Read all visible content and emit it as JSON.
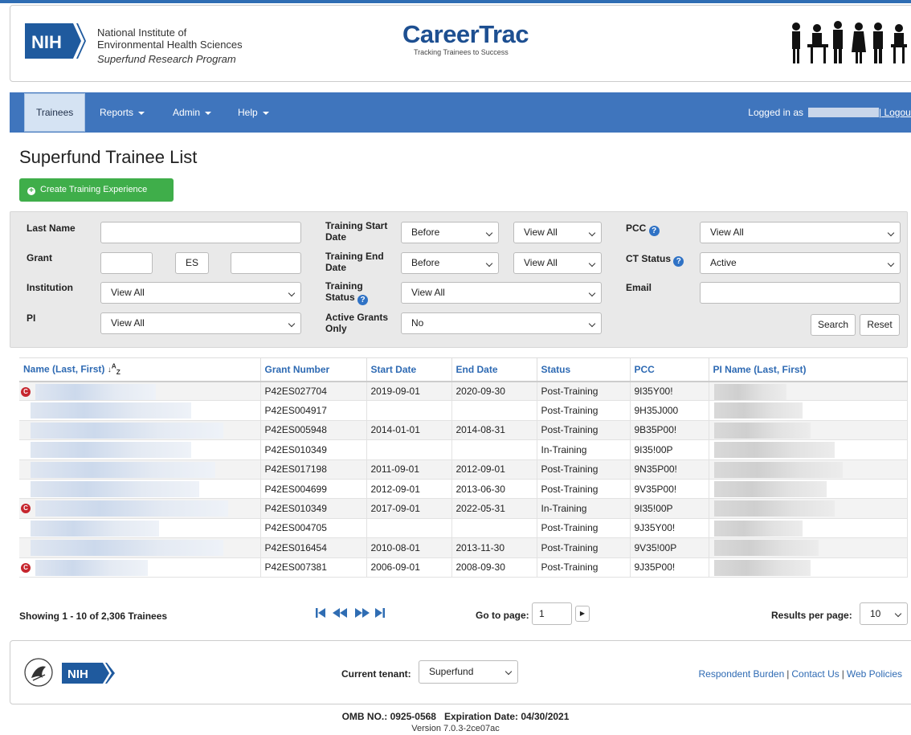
{
  "brand": {
    "nih_logo_text": "NIH",
    "institute_line1": "National Institute of",
    "institute_line2": "Environmental Health Sciences",
    "program": "Superfund Research Program",
    "app_name": "CareerTrac",
    "tagline": "Tracking Trainees to Success",
    "primary_color": "#3f75bd",
    "accent_color": "#3fae4a"
  },
  "nav": {
    "items": [
      {
        "label": "Trainees",
        "active": true
      },
      {
        "label": "Reports",
        "dropdown": true
      },
      {
        "label": "Admin",
        "dropdown": true
      },
      {
        "label": "Help",
        "dropdown": true
      }
    ],
    "logged_in_prefix": "Logged in as",
    "logout": "| Logout"
  },
  "page": {
    "title": "Superfund Trainee List",
    "create_button": "Create Training Experience"
  },
  "filters": {
    "last_name_label": "Last Name",
    "last_name_value": "",
    "grant_label": "Grant",
    "grant_prefix": "",
    "grant_ic": "ES",
    "grant_serial": "",
    "institution_label": "Institution",
    "institution_value": "View All",
    "pi_label": "PI",
    "pi_value": "View All",
    "start_date_label": "Training Start Date",
    "start_date_op": "Before",
    "start_date_value": "View All",
    "end_date_label": "Training End Date",
    "end_date_op": "Before",
    "end_date_value": "View All",
    "status_label": "Training Status",
    "status_value": "View All",
    "active_grants_label": "Active Grants Only",
    "active_grants_value": "No",
    "pcc_label": "PCC",
    "pcc_value": "View All",
    "ct_status_label": "CT Status",
    "ct_status_value": "Active",
    "email_label": "Email",
    "email_value": "",
    "search_button": "Search",
    "reset_button": "Reset"
  },
  "table": {
    "columns": [
      "Name (Last, First)",
      "Grant Number",
      "Start Date",
      "End Date",
      "Status",
      "PCC",
      "PI Name (Last, First)"
    ],
    "sort_icon": "sort-alpha-asc-icon",
    "rows": [
      {
        "badge": true,
        "grant": "P42ES027704",
        "start": "2019-09-01",
        "end": "2020-09-30",
        "status": "Post-Training",
        "pcc": "9I35Y00!"
      },
      {
        "badge": false,
        "grant": "P42ES004917",
        "start": "",
        "end": "",
        "status": "Post-Training",
        "pcc": "9H35J000"
      },
      {
        "badge": false,
        "grant": "P42ES005948",
        "start": "2014-01-01",
        "end": "2014-08-31",
        "status": "Post-Training",
        "pcc": "9B35P00!"
      },
      {
        "badge": false,
        "grant": "P42ES010349",
        "start": "",
        "end": "",
        "status": "In-Training",
        "pcc": "9I35!00P"
      },
      {
        "badge": false,
        "grant": "P42ES017198",
        "start": "2011-09-01",
        "end": "2012-09-01",
        "status": "Post-Training",
        "pcc": "9N35P00!"
      },
      {
        "badge": false,
        "grant": "P42ES004699",
        "start": "2012-09-01",
        "end": "2013-06-30",
        "status": "Post-Training",
        "pcc": "9V35P00!"
      },
      {
        "badge": true,
        "grant": "P42ES010349",
        "start": "2017-09-01",
        "end": "2022-05-31",
        "status": "In-Training",
        "pcc": "9I35!00P"
      },
      {
        "badge": false,
        "grant": "P42ES004705",
        "start": "",
        "end": "",
        "status": "Post-Training",
        "pcc": "9J35Y00!"
      },
      {
        "badge": false,
        "grant": "P42ES016454",
        "start": "2010-08-01",
        "end": "2013-11-30",
        "status": "Post-Training",
        "pcc": "9V35!00P"
      },
      {
        "badge": true,
        "grant": "P42ES007381",
        "start": "2006-09-01",
        "end": "2008-09-30",
        "status": "Post-Training",
        "pcc": "9J35P00!"
      }
    ]
  },
  "pager": {
    "showing": "Showing 1 - 10 of 2,306 Trainees",
    "goto_label": "Go to page:",
    "goto_value": "1",
    "rpp_label": "Results per page:",
    "rpp_value": "10"
  },
  "footer": {
    "nih_logo_text": "NIH",
    "tenant_label": "Current tenant:",
    "tenant_value": "Superfund",
    "links": [
      "Respondent Burden",
      "Contact Us",
      "Web Policies"
    ],
    "omb": "OMB NO.: 0925-0568   Expiration Date: 04/30/2021",
    "version": "Version 7.0.3-2ce07ac"
  }
}
